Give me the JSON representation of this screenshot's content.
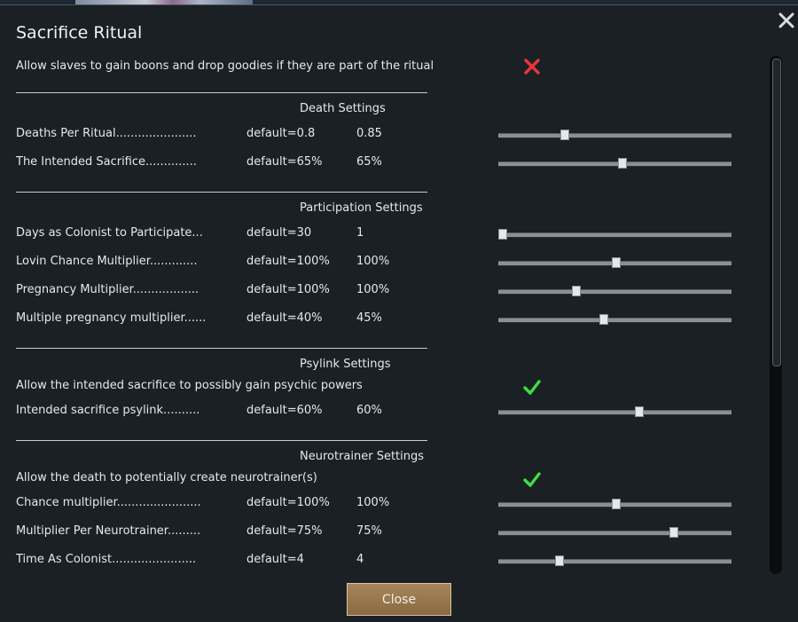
{
  "title": "Sacrifice Ritual",
  "allow_slaves": {
    "label": "Allow slaves to gain boons and drop goodies if they are part of the ritual",
    "enabled": false,
    "icon": "cross-icon"
  },
  "death": {
    "header": "Death Settings",
    "rows": [
      {
        "label": "Deaths Per Ritual......................",
        "default": "default=0.8",
        "value": "0.85",
        "level": 0.28
      },
      {
        "label": "The Intended Sacrifice..............",
        "default": "default=65%",
        "value": "65%",
        "level": 0.53
      }
    ]
  },
  "participation": {
    "header": "Participation Settings",
    "rows": [
      {
        "label": "Days as Colonist to Participate...",
        "default": "default=30",
        "value": "1",
        "level": 0.0
      },
      {
        "label": "Lovin Chance Multiplier.............",
        "default": "default=100%",
        "value": "100%",
        "level": 0.5
      },
      {
        "label": "Pregnancy Multiplier..................",
        "default": "default=100%",
        "value": "100%",
        "level": 0.33
      },
      {
        "label": "Multiple pregnancy multiplier......",
        "default": "default=40%",
        "value": "45%",
        "level": 0.45
      }
    ]
  },
  "psylink": {
    "header": "Psylink Settings",
    "allow": {
      "label": "Allow the intended sacrifice to possibly gain psychic powers",
      "enabled": true,
      "icon": "checkmark-icon"
    },
    "rows": [
      {
        "label": "Intended sacrifice psylink..........",
        "default": "default=60%",
        "value": "60%",
        "level": 0.6
      }
    ]
  },
  "neurotrainer": {
    "header": "Neurotrainer Settings",
    "allow": {
      "label": "Allow the death to potentially create neurotrainer(s)",
      "enabled": true,
      "icon": "checkmark-icon"
    },
    "rows": [
      {
        "label": "Chance multiplier.......................",
        "default": "default=100%",
        "value": "100%",
        "level": 0.5
      },
      {
        "label": "Multiplier Per Neurotrainer.........",
        "default": "default=75%",
        "value": "75%",
        "level": 0.75
      },
      {
        "label": "Time As Colonist.......................",
        "default": "default=4",
        "value": "4",
        "level": 0.26
      }
    ]
  },
  "close_label": "Close",
  "colors": {
    "cross": "#e8363b",
    "check": "#3ee03e",
    "button": "#9a7a4f"
  }
}
